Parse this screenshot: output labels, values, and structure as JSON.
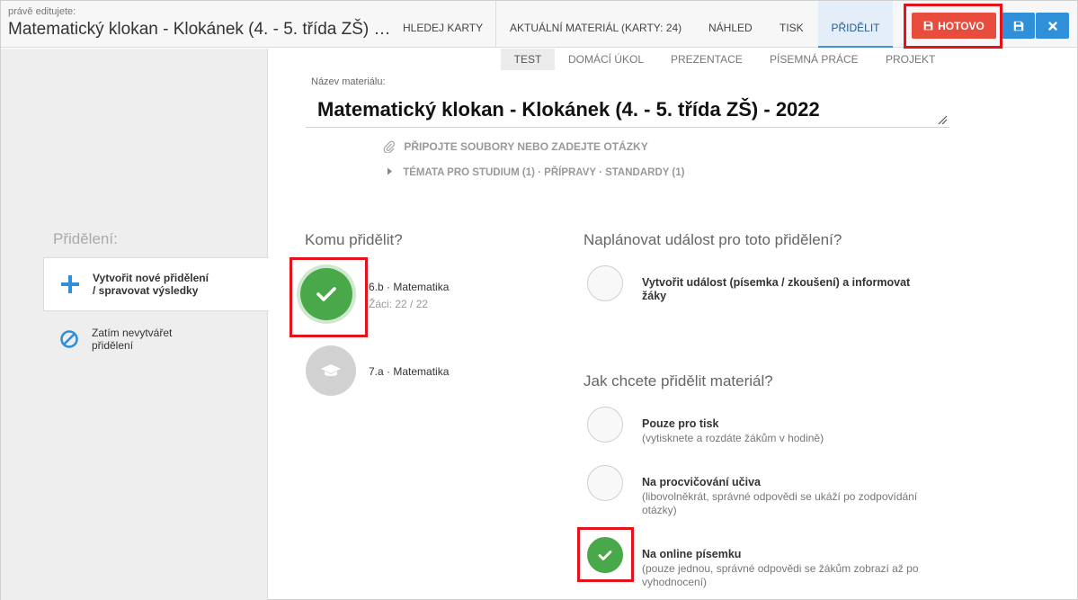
{
  "header": {
    "editing_label": "právě editujete:",
    "editing_title": "Matematický klokan - Klokánek (4. - 5. třída ZŠ) …",
    "tabs": [
      {
        "label": "HLEDEJ KARTY"
      },
      {
        "label": "AKTUÁLNÍ MATERIÁL (KARTY: 24)"
      },
      {
        "label": "NÁHLED"
      },
      {
        "label": "TISK"
      },
      {
        "label": "PŘIDĚLIT"
      }
    ],
    "done_label": "HOTOVO"
  },
  "subtabs": [
    {
      "label": "TEST"
    },
    {
      "label": "DOMÁCÍ ÚKOL"
    },
    {
      "label": "PREZENTACE"
    },
    {
      "label": "PÍSEMNÁ PRÁCE"
    },
    {
      "label": "PROJEKT"
    }
  ],
  "material": {
    "field_label": "Název materiálu:",
    "name": "Matematický klokan - Klokánek (4. - 5. třída ZŠ) - 2022",
    "attach_label": "PŘIPOJTE SOUBORY NEBO ZADEJTE OTÁZKY",
    "topics_label": "TÉMATA PRO STUDIUM (1) · PŘÍPRAVY · STANDARDY (1)"
  },
  "sidebar": {
    "title": "Přidělení:",
    "items": [
      {
        "line1": "Vytvořit nové přidělení",
        "line2": "/ spravovat výsledky"
      },
      {
        "line1": "Zatím nevytvářet",
        "line2": "přidělení"
      }
    ]
  },
  "assign": {
    "title": "Komu přidělit?",
    "classes": [
      {
        "name": "6.b · Matematika",
        "sub": "Žáci: 22 / 22",
        "selected": true
      },
      {
        "name": "7.a · Matematika",
        "sub": "",
        "selected": false
      }
    ]
  },
  "event": {
    "title": "Naplánovat událost pro toto přidělení?",
    "option_line1": "Vytvořit událost (písemka / zkoušení) a informovat",
    "option_line2": "žáky"
  },
  "mode": {
    "title": "Jak chcete přidělit materiál?",
    "options": [
      {
        "title": "Pouze pro tisk",
        "desc1": "(vytisknete a rozdáte žákům v hodině)",
        "desc2": "",
        "checked": false
      },
      {
        "title": "Na procvičování učiva",
        "desc1": "(libovolněkrát, správné odpovědi se ukáží po zodpovídání",
        "desc2": "otázky)",
        "checked": false
      },
      {
        "title": "Na online písemku",
        "desc1": "(pouze jednou, správné odpovědi se žákům zobrazí až po",
        "desc2": "vyhodnocení)",
        "checked": true
      }
    ]
  },
  "colors": {
    "done_button": "#e74c3c",
    "primary_button": "#2f8fd8",
    "selected_green": "#48a84a",
    "highlight_box": "#e4121b"
  }
}
